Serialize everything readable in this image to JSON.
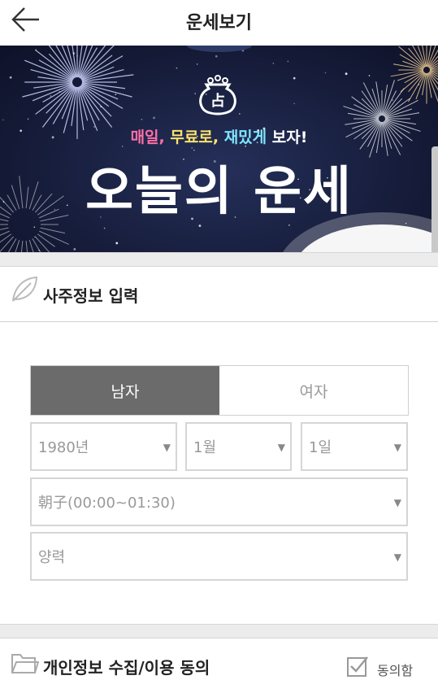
{
  "header": {
    "title": "운세보기"
  },
  "banner": {
    "tagline_a": "매일,",
    "tagline_b": "무료로,",
    "tagline_c": "재밌게",
    "tagline_d": "보자!",
    "headline": "오늘의 운세",
    "logo_glyph": "占"
  },
  "saju": {
    "section_label": "사주정보 입력",
    "gender": {
      "male": "남자",
      "female": "여자",
      "selected": "남자"
    },
    "year": "1980년",
    "month": "1월",
    "day": "1일",
    "time": "朝子(00:00~01:30)",
    "calendar": "양력"
  },
  "consent": {
    "section_label": "개인정보 수집/이용 동의",
    "agree_label": "동의함"
  },
  "icons": {
    "back": "arrow-left-icon",
    "leaf": "leaf-icon",
    "folder": "folder-icon",
    "check": "checkbox-icon",
    "dropdown": "triangle-down-icon"
  },
  "colors": {
    "selected_tab": "#6b6b6b",
    "banner_bg": "#161c3a",
    "tag_pink": "#ff6fa6",
    "tag_yellow": "#ffe36b",
    "tag_cyan": "#7fe4ff"
  }
}
